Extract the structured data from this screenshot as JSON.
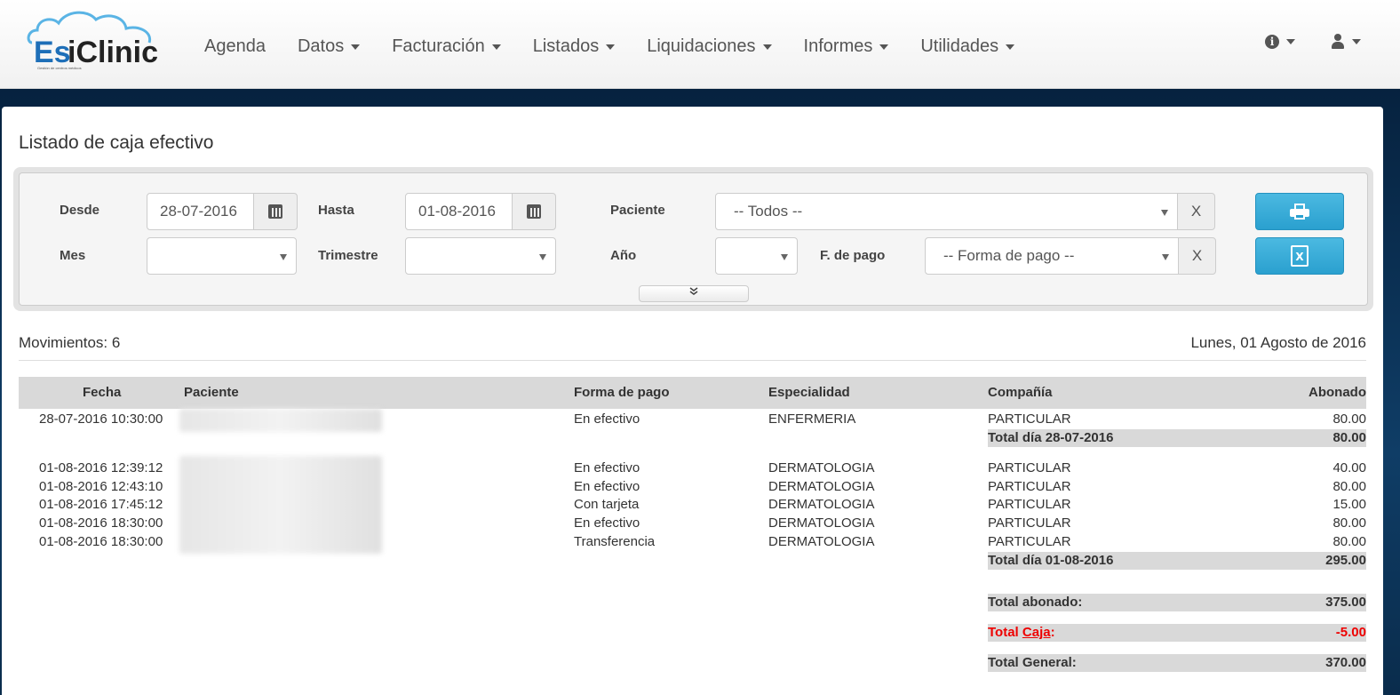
{
  "app": {
    "logo_text": "EsiClinic",
    "logo_tagline": "Gestión de centros médicos"
  },
  "nav": {
    "items": [
      {
        "label": "Agenda",
        "dropdown": false
      },
      {
        "label": "Datos",
        "dropdown": true
      },
      {
        "label": "Facturación",
        "dropdown": true
      },
      {
        "label": "Listados",
        "dropdown": true
      },
      {
        "label": "Liquidaciones",
        "dropdown": true
      },
      {
        "label": "Informes",
        "dropdown": true
      },
      {
        "label": "Utilidades",
        "dropdown": true
      }
    ],
    "right_icons": [
      "info-icon",
      "user-icon"
    ]
  },
  "page": {
    "title": "Listado de caja efectivo"
  },
  "filters": {
    "desde_label": "Desde",
    "desde_value": "28-07-2016",
    "hasta_label": "Hasta",
    "hasta_value": "01-08-2016",
    "paciente_label": "Paciente",
    "paciente_value": "-- Todos --",
    "mes_label": "Mes",
    "mes_value": "",
    "trimestre_label": "Trimestre",
    "trimestre_value": "",
    "anio_label": "Año",
    "anio_value": "",
    "fpago_label": "F. de pago",
    "fpago_value": "-- Forma de pago --",
    "clear_label": "X",
    "expand_label": "»"
  },
  "summary": {
    "movimientos": "Movimientos: 6",
    "date": "Lunes, 01 Agosto de 2016"
  },
  "table": {
    "headers": {
      "fecha": "Fecha",
      "paciente": "Paciente",
      "forma": "Forma de pago",
      "especialidad": "Especialidad",
      "compania": "Compañía",
      "abonado": "Abonado"
    },
    "rows": [
      {
        "fecha": "28-07-2016 10:30:00",
        "forma": "En efectivo",
        "especialidad": "ENFERMERIA",
        "compania": "PARTICULAR",
        "abonado": "80.00"
      },
      {
        "fecha": "01-08-2016 12:39:12",
        "forma": "En efectivo",
        "especialidad": "DERMATOLOGIA",
        "compania": "PARTICULAR",
        "abonado": "40.00"
      },
      {
        "fecha": "01-08-2016 12:43:10",
        "forma": "En efectivo",
        "especialidad": "DERMATOLOGIA",
        "compania": "PARTICULAR",
        "abonado": "80.00"
      },
      {
        "fecha": "01-08-2016 17:45:12",
        "forma": "Con tarjeta",
        "especialidad": "DERMATOLOGIA",
        "compania": "PARTICULAR",
        "abonado": "15.00"
      },
      {
        "fecha": "01-08-2016 18:30:00",
        "forma": "En efectivo",
        "especialidad": "DERMATOLOGIA",
        "compania": "PARTICULAR",
        "abonado": "80.00"
      },
      {
        "fecha": "01-08-2016 18:30:00",
        "forma": "Transferencia",
        "especialidad": "DERMATOLOGIA",
        "compania": "PARTICULAR",
        "abonado": "80.00"
      }
    ],
    "subtotals": [
      {
        "label": "Total día 28-07-2016",
        "value": "80.00"
      },
      {
        "label": "Total día 01-08-2016",
        "value": "295.00"
      }
    ],
    "totals": {
      "abonado_label": "Total abonado:",
      "abonado_value": "375.00",
      "caja_prefix": "Total ",
      "caja_link": "Caja",
      "caja_suffix": ":",
      "caja_value": "-5.00",
      "general_label": "Total General:",
      "general_value": "370.00"
    }
  },
  "colors": {
    "accent": "#2aa0cf",
    "negative": "#e00000",
    "header_bg": "#d9d9d9"
  }
}
